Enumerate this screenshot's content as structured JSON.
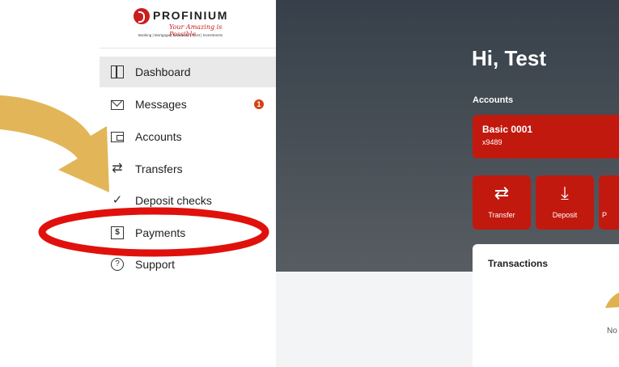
{
  "logo": {
    "brand": "PROFINIUM",
    "tagline": "Your Amazing is Possible",
    "subline": "Banking | Mortgage | Insurance | Trust | Investments"
  },
  "sidebar": {
    "items": [
      {
        "label": "Dashboard",
        "icon": "dashboard-icon",
        "active": true
      },
      {
        "label": "Messages",
        "icon": "mail-icon",
        "badge": "1"
      },
      {
        "label": "Accounts",
        "icon": "wallet-icon"
      },
      {
        "label": "Transfers",
        "icon": "transfer-icon"
      },
      {
        "label": "Deposit checks",
        "icon": "deposit-icon"
      },
      {
        "label": "Payments",
        "icon": "receipt-icon"
      },
      {
        "label": "Support",
        "icon": "help-icon"
      }
    ]
  },
  "main": {
    "greeting": "Hi, Test",
    "accounts_label": "Accounts",
    "account": {
      "name": "Basic 0001",
      "number": "x9489"
    },
    "actions": [
      {
        "label": "Transfer",
        "icon": "transfer-icon"
      },
      {
        "label": "Deposit",
        "icon": "download-icon"
      },
      {
        "label": "P",
        "icon": "payment-icon"
      }
    ],
    "transactions_title": "Transactions",
    "transactions_empty": "No"
  },
  "colors": {
    "brand_red": "#c2190f",
    "hero_dark": "#37404a",
    "badge_orange": "#d54312",
    "annotation_gold": "#e0b24f",
    "annotation_red": "#e0110c"
  }
}
